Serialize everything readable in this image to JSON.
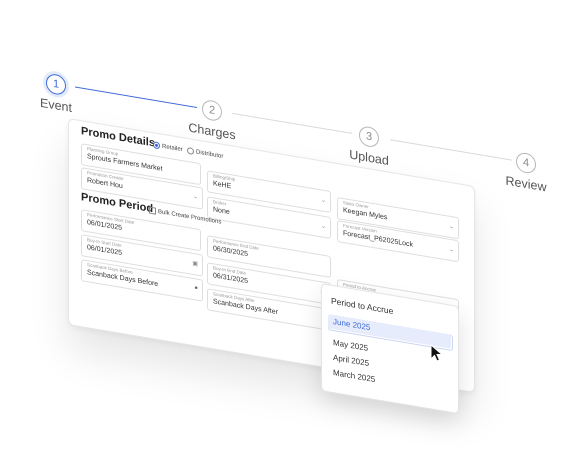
{
  "stepper": {
    "steps": [
      {
        "num": "1",
        "label": "Event"
      },
      {
        "num": "2",
        "label": "Charges"
      },
      {
        "num": "3",
        "label": "Upload"
      },
      {
        "num": "4",
        "label": "Review"
      }
    ],
    "active_color": "#3f6bd8"
  },
  "promo_details": {
    "title": "Promo Details",
    "radio_retailer": "Retailer",
    "radio_distributor": "Distributor",
    "planning_group": {
      "label": "Planning Group",
      "value": "Sprouts Farmers Market"
    },
    "promotion_creator": {
      "label": "Promotion Creator",
      "value": "Robert Hou"
    },
    "billing_ship": {
      "label": "Billing/Ship",
      "value": "KeHE"
    },
    "broker": {
      "label": "Broker",
      "value": "None"
    },
    "sales_owner": {
      "label": "Sales Owner",
      "value": "Keegan Myles"
    },
    "forecast_version": {
      "label": "Forecast Version",
      "value": "Forecast_P62025Lock"
    }
  },
  "promo_period": {
    "title": "Promo Period",
    "bulk_create": "Bulk Create Promotions",
    "performance_start": {
      "label": "Performance Start Date",
      "value": "06/01/2025"
    },
    "performance_end": {
      "label": "Performance End Date",
      "value": "06/30/2025"
    },
    "buy_in_start": {
      "label": "Buy-In Start Date",
      "value": "06/01/2025"
    },
    "buy_in_end": {
      "label": "Buy-In End Date",
      "value": "06/31/2025"
    },
    "scanback_before": {
      "label": "Scanback Days Before",
      "value": "Scanback Days Before"
    },
    "scanback_after": {
      "label": "Scanback Days After",
      "value": "Scanback Days After"
    },
    "period_to_accrue": {
      "label": "Period to Accrue"
    }
  },
  "dropdown": {
    "title": "Period to Accrue",
    "options": [
      "June 2025",
      "May 2025",
      "April 2025",
      "March 2025"
    ],
    "selected_index": 0
  }
}
